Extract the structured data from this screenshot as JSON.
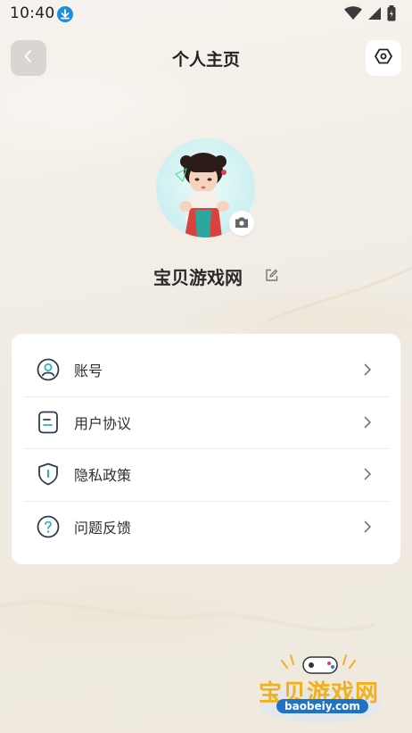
{
  "status_bar": {
    "time": "10:40"
  },
  "header": {
    "title": "个人主页"
  },
  "profile": {
    "username": "宝贝游戏网"
  },
  "menu": {
    "items": [
      {
        "label": "账号",
        "icon": "user-circle-icon"
      },
      {
        "label": "用户协议",
        "icon": "document-icon"
      },
      {
        "label": "隐私政策",
        "icon": "shield-icon"
      },
      {
        "label": "问题反馈",
        "icon": "question-circle-icon"
      }
    ]
  },
  "watermark": {
    "title": "宝贝游戏网",
    "url": "baobeiy.com"
  },
  "colors": {
    "accent": "#2fb3b3",
    "icon_stroke": "#2c3e50",
    "background": "#f3efe7",
    "watermark_yellow": "#f2b11a",
    "watermark_blue": "#1e73c8"
  }
}
